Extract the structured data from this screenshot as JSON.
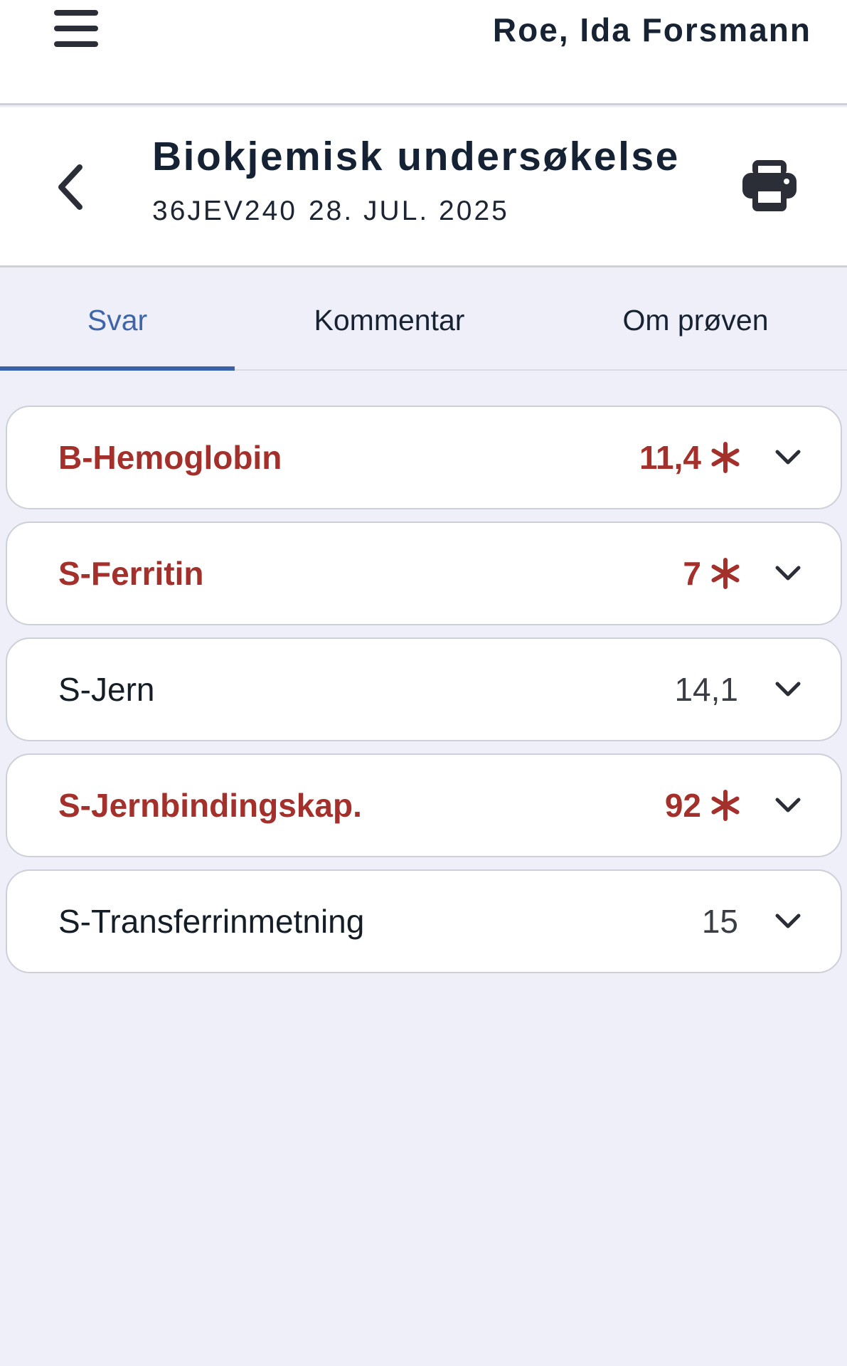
{
  "topbar": {
    "patient_name": "Roe, Ida Forsmann",
    "menu_icon": "hamburger-menu-icon"
  },
  "header": {
    "title": "Biokjemisk undersøkelse",
    "sample_id": "36JEV240",
    "date": "28. JUL. 2025",
    "back_icon": "chevron-left-icon",
    "print_icon": "printer-icon"
  },
  "tabs": [
    {
      "label": "Svar",
      "active": true
    },
    {
      "label": "Kommentar",
      "active": false
    },
    {
      "label": "Om prøven",
      "active": false
    }
  ],
  "results": [
    {
      "name": "B-Hemoglobin",
      "value": "11,4",
      "abnormal": true
    },
    {
      "name": "S-Ferritin",
      "value": "7",
      "abnormal": true
    },
    {
      "name": "S-Jern",
      "value": "14,1",
      "abnormal": false
    },
    {
      "name": "S-Jernbindingskap.",
      "value": "92",
      "abnormal": true
    },
    {
      "name": "S-Transferrinmetning",
      "value": "15",
      "abnormal": false
    }
  ],
  "colors": {
    "accent": "#3e65a8",
    "abnormal": "#a3302b",
    "background": "#eeeff8"
  }
}
